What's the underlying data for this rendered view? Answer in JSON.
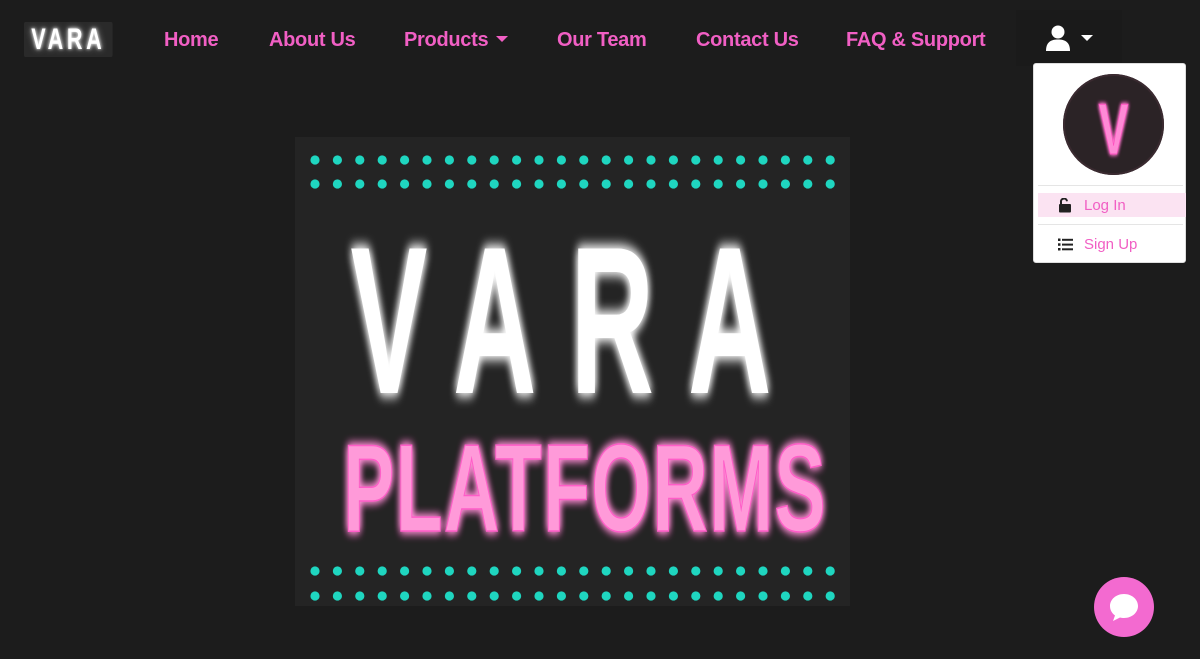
{
  "brand": {
    "logo_text": "VARA"
  },
  "nav": {
    "home": "Home",
    "about": "About Us",
    "products": "Products",
    "team": "Our Team",
    "contact": "Contact Us",
    "faq": "FAQ & Support"
  },
  "user_menu": {
    "avatar_letter": "V",
    "items": [
      {
        "label": "Log In",
        "icon": "unlock-icon"
      },
      {
        "label": "Sign Up",
        "icon": "list-icon"
      }
    ]
  },
  "hero": {
    "title": "VARA",
    "subtitle": "PLATFORMS"
  },
  "colors": {
    "accent": "#f15fc4",
    "dots": "#1fd6c0",
    "background": "#1c1c1c"
  },
  "chat": {
    "icon": "chat-bubble-icon"
  }
}
